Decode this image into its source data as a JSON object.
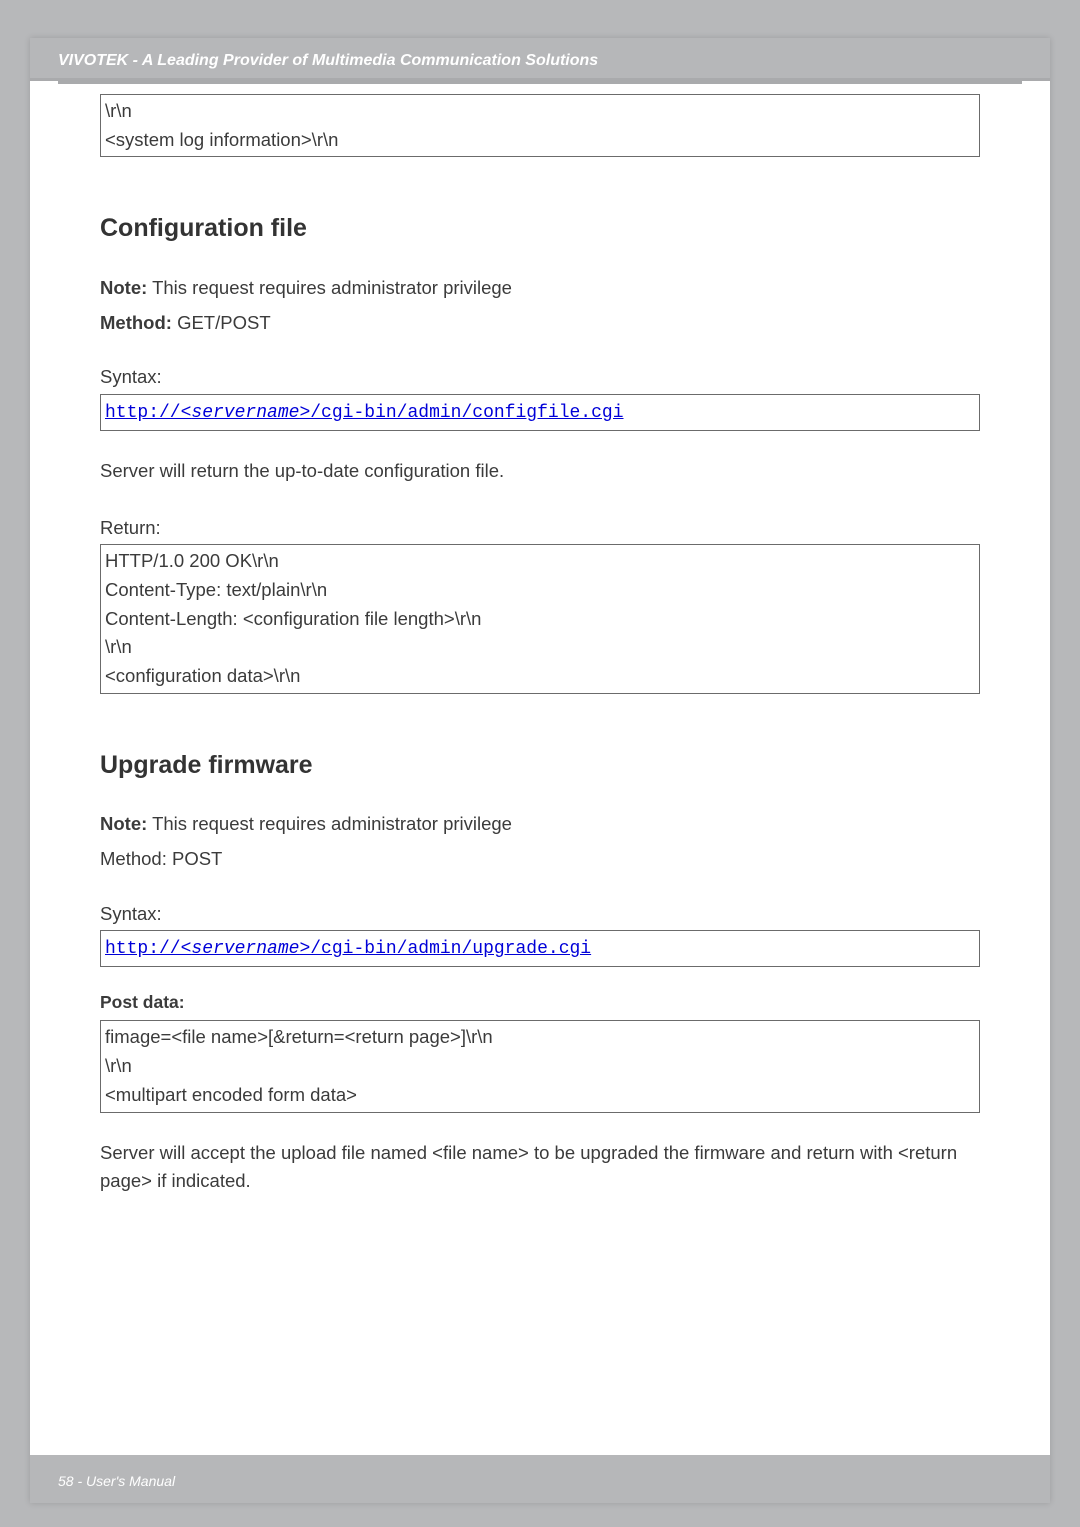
{
  "header": {
    "title": "VIVOTEK - A Leading Provider of Multimedia Communication Solutions"
  },
  "box1": {
    "l1": "\\r\\n",
    "l2": "<system log information>\\r\\n"
  },
  "sec1": {
    "title": "Configuration file",
    "note_label": "Note:",
    "note_text": " This request requires administrator privilege",
    "method_label": "Method:",
    "method_text": " GET/POST",
    "syntax_label": "Syntax:",
    "url_pre": "http://<",
    "url_srv": "servername",
    "url_post": ">/cgi-bin/admin/configfile.cgi",
    "narr": "Server will return the up-to-date configuration file.",
    "ret_label": "Return:",
    "ret_l1": "HTTP/1.0 200 OK\\r\\n",
    "ret_l2": "Content-Type: text/plain\\r\\n",
    "ret_l3": "Content-Length: <configuration file length>\\r\\n",
    "ret_l4": "\\r\\n",
    "ret_l5": "<configuration data>\\r\\n"
  },
  "sec2": {
    "title": "Upgrade firmware",
    "note_label": "Note:",
    "note_text": " This request requires administrator privilege",
    "method_line": "Method: POST",
    "syntax_label": "Syntax:",
    "url_pre": "http://<",
    "url_srv": "servername",
    "url_post": ">/cgi-bin/admin/upgrade.cgi",
    "postdata_label": "Post data:",
    "pd_l1": "fimage=<file name>[&return=<return page>]\\r\\n",
    "pd_l2": "\\r\\n",
    "pd_l3": "<multipart encoded form data>",
    "narr": "Server will accept the upload file named <file name> to be upgraded the firmware and return with <return page> if indicated."
  },
  "footer": {
    "text": "58 - User's Manual"
  }
}
